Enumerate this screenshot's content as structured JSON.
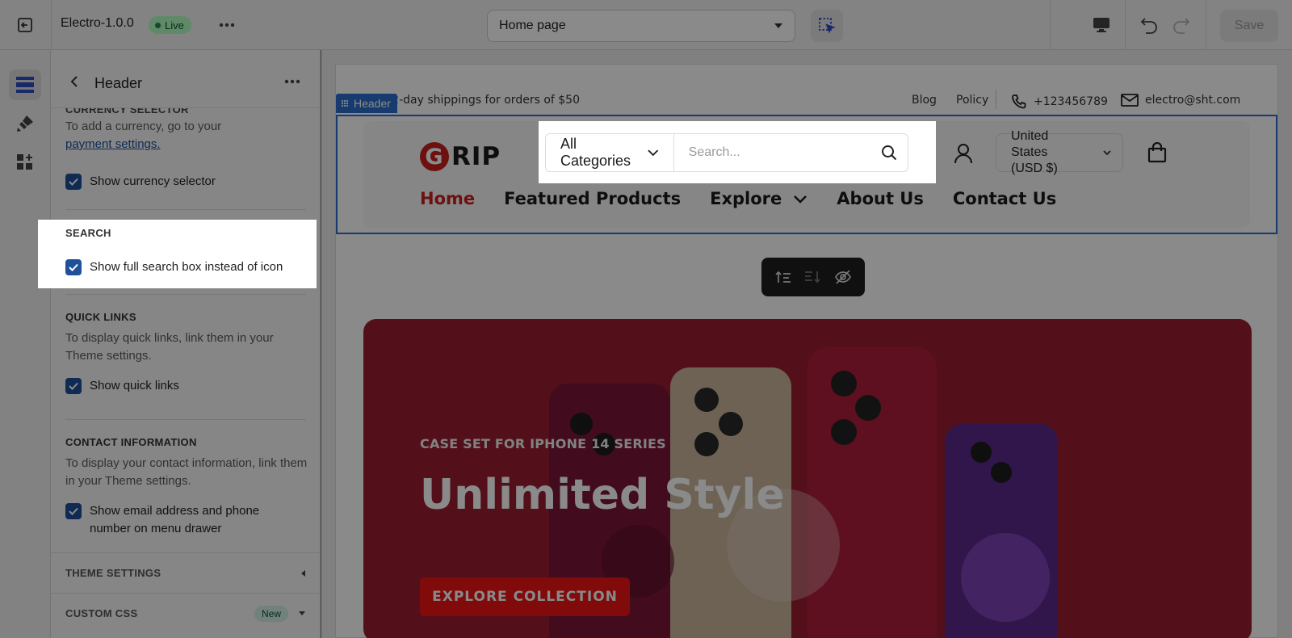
{
  "topbar": {
    "app_title": "Electro-1.0.0",
    "live_badge": "Live",
    "page_select_value": "Home page",
    "save_label": "Save"
  },
  "panel": {
    "title": "Header",
    "cut_heading": "CURRENCY SELECTOR",
    "currency": {
      "text": "To add a currency, go to your",
      "link": "payment settings.",
      "checkbox_label": "Show currency selector",
      "checked": true
    },
    "search": {
      "heading": "SEARCH",
      "checkbox_label": "Show full search box instead of icon",
      "checked": true
    },
    "quick_links": {
      "heading": "QUICK LINKS",
      "text": "To display quick links, link them in your Theme settings.",
      "checkbox_label": "Show quick links",
      "checked": true
    },
    "contact": {
      "heading": "CONTACT INFORMATION",
      "text": "To display your contact information, link them in your Theme settings.",
      "checkbox_label": "Show email address and phone number on menu drawer",
      "checked": true
    },
    "theme_settings": "THEME SETTINGS",
    "custom_css": "CUSTOM CSS",
    "new_badge": "New"
  },
  "preview": {
    "announcement": "Free 2-day shippings for orders of $50",
    "top_links": [
      "Blog",
      "Policy"
    ],
    "phone": "+123456789",
    "email": "electro@sht.com",
    "section_tag": "Header",
    "logo_letter": "G",
    "logo_rest": "RIP",
    "category_select": "All Categories",
    "search_placeholder": "Search...",
    "currency_line1": "United",
    "currency_line2": "States",
    "currency_line3": "(USD $)",
    "nav": [
      "Home",
      "Featured Products",
      "Explore",
      "About Us",
      "Contact Us"
    ],
    "hero": {
      "subtitle": "CASE SET FOR IPHONE 14 SERIES",
      "title": "Unlimited Style",
      "cta": "EXPLORE COLLECTION"
    }
  },
  "colors": {
    "accent_blue": "#2c6ecb",
    "checkbox_blue": "#1f5199",
    "brand_red": "#c71e1e",
    "hero_bg": "#9c1f30",
    "cta_red": "#ef1515"
  }
}
